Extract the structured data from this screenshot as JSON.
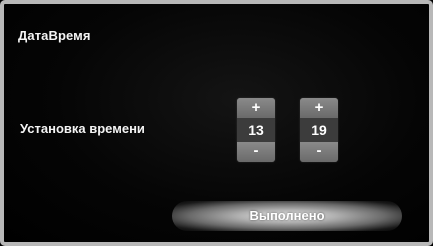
{
  "header": {
    "title": "ДатаВремя"
  },
  "time_setting": {
    "label": "Установка времени",
    "hours": {
      "increment_label": "+",
      "value": "13",
      "decrement_label": "-"
    },
    "minutes": {
      "increment_label": "+",
      "value": "19",
      "decrement_label": "-"
    }
  },
  "actions": {
    "done_label": "Выполнено"
  },
  "colors": {
    "background": "#000000",
    "frame": "#b8b8b8",
    "spinner_button": "#7a7a7a",
    "text": "#f4f4f4"
  }
}
